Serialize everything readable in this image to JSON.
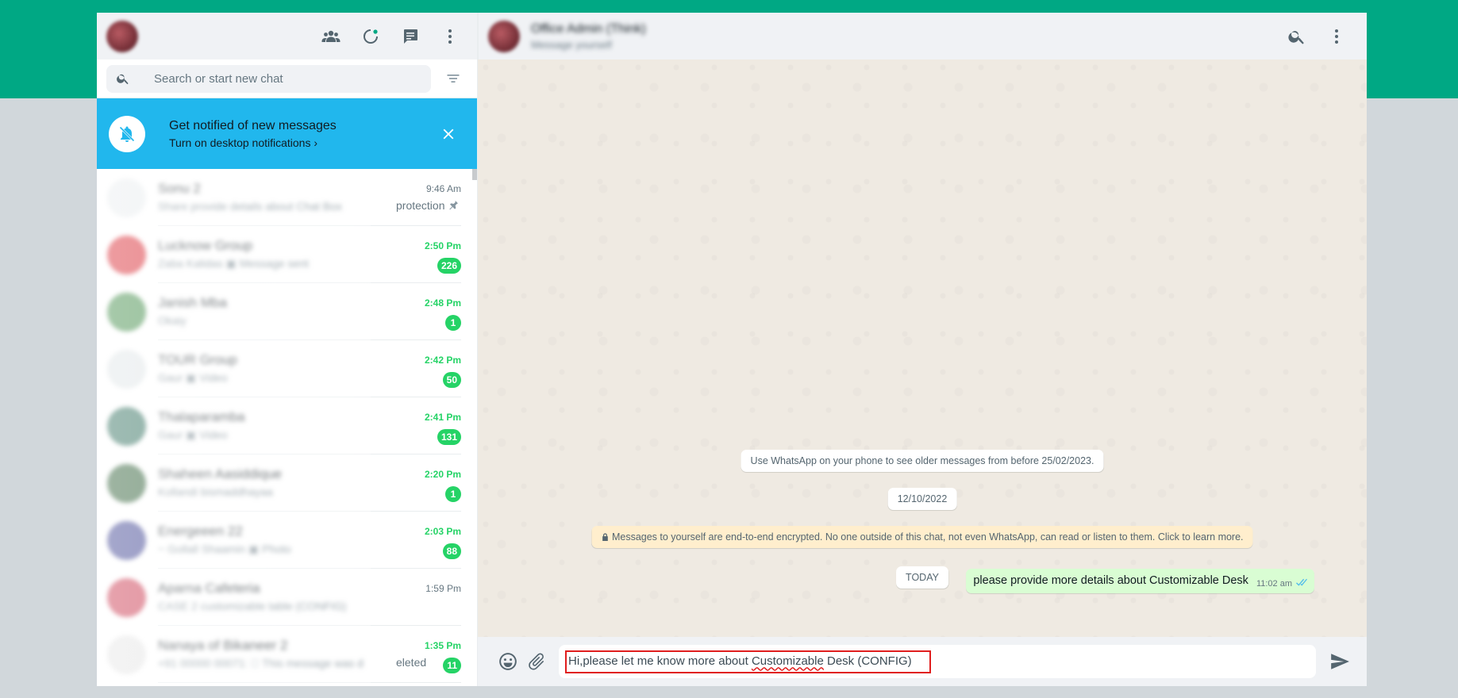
{
  "left_header": {
    "icons": [
      "communities-icon",
      "status-icon",
      "new-chat-icon",
      "menu-icon"
    ]
  },
  "search": {
    "placeholder": "Search or start new chat"
  },
  "notification": {
    "title": "Get notified of new messages",
    "subtitle": "Turn on desktop notifications ›"
  },
  "chats": [
    {
      "name": "Sonu 2",
      "preview": "Share provide details about Chat Box",
      "preview_visible": "protection",
      "time": "9:46 Am",
      "unread": "",
      "pinned": true,
      "avatar_color": "#e9edef"
    },
    {
      "name": "Lucknow Group",
      "preview": "Zaba Kalidas ▣ Message sent",
      "preview_visible": "",
      "time": "2:50 Pm",
      "unread": "226",
      "pinned": false,
      "avatar_color": "#d8262f"
    },
    {
      "name": "Janish Mba",
      "preview": "Okaiy",
      "preview_visible": "",
      "time": "2:48 Pm",
      "unread": "1",
      "pinned": false,
      "avatar_color": "#3e8a45"
    },
    {
      "name": "TOUR Group",
      "preview": "Gaur ▣ Video",
      "preview_visible": "",
      "time": "2:42 Pm",
      "unread": "50",
      "pinned": false,
      "avatar_color": "#dfe5e7"
    },
    {
      "name": "Thalaparamba",
      "preview": "Gaur ▣ Video",
      "preview_visible": "",
      "time": "2:41 Pm",
      "unread": "131",
      "pinned": false,
      "avatar_color": "#2e6d5b"
    },
    {
      "name": "Shaheen Aasiddique",
      "preview": "Kollandi bismaddhayaa",
      "preview_visible": "",
      "time": "2:20 Pm",
      "unread": "1",
      "pinned": false,
      "avatar_color": "#2b5c33"
    },
    {
      "name": "Energeeen 22",
      "preview": "~ Gollall Shaamin ▣ Photo",
      "preview_visible": "",
      "time": "2:03 Pm",
      "unread": "88",
      "pinned": false,
      "avatar_color": "#3a3f8f"
    },
    {
      "name": "Aparna Cafeteria",
      "preview": "CASE 2 customizable table (CONFIG)",
      "preview_visible": "",
      "time": "1:59 Pm",
      "unread": "",
      "pinned": false,
      "avatar_color": "#c9344b"
    },
    {
      "name": "Nanaya of Bikaneer 2",
      "preview": "+91 00000 00071: ⃠ This message was d",
      "preview_visible": "eleted",
      "time": "1:35 Pm",
      "unread": "11",
      "pinned": false,
      "avatar_color": "#e5e5e5"
    }
  ],
  "conversation": {
    "name": "Office Admin (Think)",
    "status": "Message yourself"
  },
  "messages": {
    "older_notice": "Use WhatsApp on your phone to see older messages from before 25/02/2023.",
    "date_1": "12/10/2022",
    "encryption": "Messages to yourself are end-to-end encrypted. No one outside of this chat, not even WhatsApp, can read or listen to them. Click to learn more.",
    "date_2": "TODAY",
    "outgoing": {
      "text": "please provide more details about  Customizable Desk",
      "time": "11:02 am"
    }
  },
  "composer": {
    "text_before": "Hi,please let me know more about ",
    "text_misspelled": "Customizable",
    "text_after": " Desk (CONFIG)"
  }
}
